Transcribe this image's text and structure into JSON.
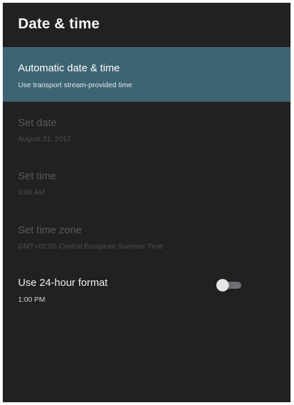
{
  "header": {
    "title": "Date & time"
  },
  "settings": {
    "items": [
      {
        "label": "Automatic date & time",
        "summary": "Use transport stream-provided time",
        "state": "selected"
      },
      {
        "label": "Set date",
        "summary": "August 31, 2017",
        "state": "disabled"
      },
      {
        "label": "Set time",
        "summary": "3:06 AM",
        "state": "disabled"
      },
      {
        "label": "Set time zone",
        "summary": "GMT+02:00 Central European Summer Time",
        "state": "disabled"
      },
      {
        "label": "Use 24-hour format",
        "summary": "1:00 PM",
        "state": "enabled",
        "toggle_on": false
      }
    ]
  },
  "colors": {
    "panel_background": "#212123",
    "selected_background": "#3d6473",
    "text_primary": "#f1f1f1",
    "text_disabled": "#5a5a5e",
    "toggle_thumb": "#e6e6e6",
    "toggle_track": "#6f6f73"
  },
  "icons": {
    "toggle": "switch-off"
  }
}
